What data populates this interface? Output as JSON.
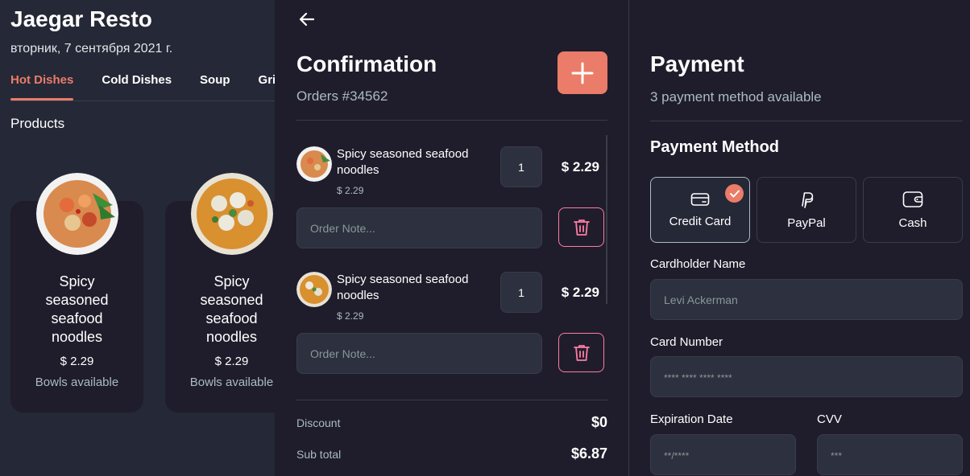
{
  "colors": {
    "accent": "#EA7C69",
    "danger": "#FF7CA3",
    "bg": "#1F1D2B",
    "surface": "#252836",
    "input": "#2D303E"
  },
  "left": {
    "brand": "Jaegar Resto",
    "date": "вторник, 7 сентября 2021 г.",
    "tabs": [
      "Hot Dishes",
      "Cold Dishes",
      "Soup",
      "Grill"
    ],
    "active_tab": "Hot Dishes",
    "products_label": "Products",
    "products": [
      {
        "name": "Spicy seasoned seafood noodles",
        "price": "$ 2.29",
        "availability": "Bowls available"
      },
      {
        "name": "Spicy seasoned seafood noodles",
        "price": "$ 2.29",
        "availability": "Bowls available"
      }
    ]
  },
  "confirmation": {
    "back_icon": "arrow-left-icon",
    "title": "Confirmation",
    "order_number": "Orders #34562",
    "add_icon": "plus-icon",
    "items": [
      {
        "name": "Spicy seasoned seafood noodles",
        "price": "$ 2.29",
        "qty": "1",
        "total": "$ 2.29",
        "note_placeholder": "Order Note..."
      },
      {
        "name": "Spicy seasoned seafood noodles",
        "price": "$ 2.29",
        "qty": "1",
        "total": "$ 2.29",
        "note_placeholder": "Order Note..."
      }
    ],
    "discount_label": "Discount",
    "discount_value": "$0",
    "subtotal_label": "Sub total",
    "subtotal_value": "$6.87"
  },
  "payment": {
    "title": "Payment",
    "subtitle": "3 payment method available",
    "method_heading": "Payment Method",
    "methods": [
      {
        "label": "Credit Card",
        "icon": "credit-card-icon",
        "selected": true
      },
      {
        "label": "PayPal",
        "icon": "paypal-icon",
        "selected": false
      },
      {
        "label": "Cash",
        "icon": "wallet-icon",
        "selected": false
      }
    ],
    "cardholder_label": "Cardholder Name",
    "cardholder_placeholder": "Levi Ackerman",
    "card_number_label": "Card Number",
    "card_number_placeholder": "**** **** **** ****",
    "expiration_label": "Expiration Date",
    "expiration_placeholder": "**/****",
    "cvv_label": "CVV",
    "cvv_placeholder": "***"
  }
}
